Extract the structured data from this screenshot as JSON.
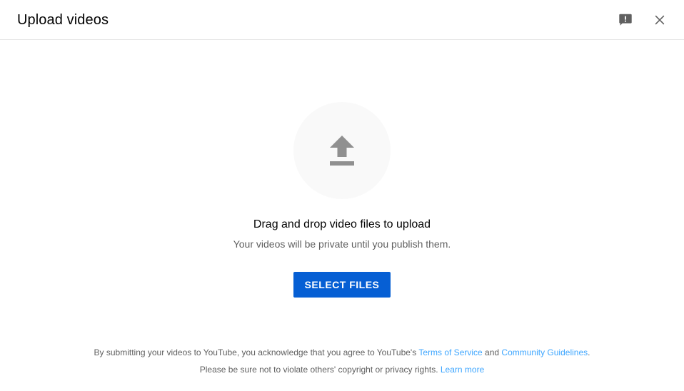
{
  "dialog": {
    "title": "Upload videos",
    "header_actions": [
      {
        "name": "send-feedback-icon",
        "label": "Send feedback"
      },
      {
        "name": "close-icon",
        "label": "Close"
      }
    ]
  },
  "dropzone": {
    "upload_icon": "upload-arrow-icon",
    "headline": "Drag and drop video files to upload",
    "subtext": "Your videos will be private until you publish them.",
    "select_files_label": "SELECT FILES"
  },
  "legal": {
    "line1_part1": "By submitting your videos to YouTube, you acknowledge that you agree to YouTube's ",
    "line1_link1": "Terms of Service",
    "line1_part2": " and ",
    "line1_link2": "Community Guidelines",
    "line1_part3": ".",
    "line2_part1": "Please be sure not to violate others' copyright or privacy rights. ",
    "line2_link1": "Learn more"
  },
  "colors": {
    "accent_button": "#065fd4",
    "link": "#3ea6ff",
    "text_primary": "#030303",
    "text_secondary": "#606060",
    "circle_bg": "#f9f9f9",
    "divider": "#e5e5e5",
    "icon_grey": "#606060",
    "arrow_grey": "#909090"
  }
}
